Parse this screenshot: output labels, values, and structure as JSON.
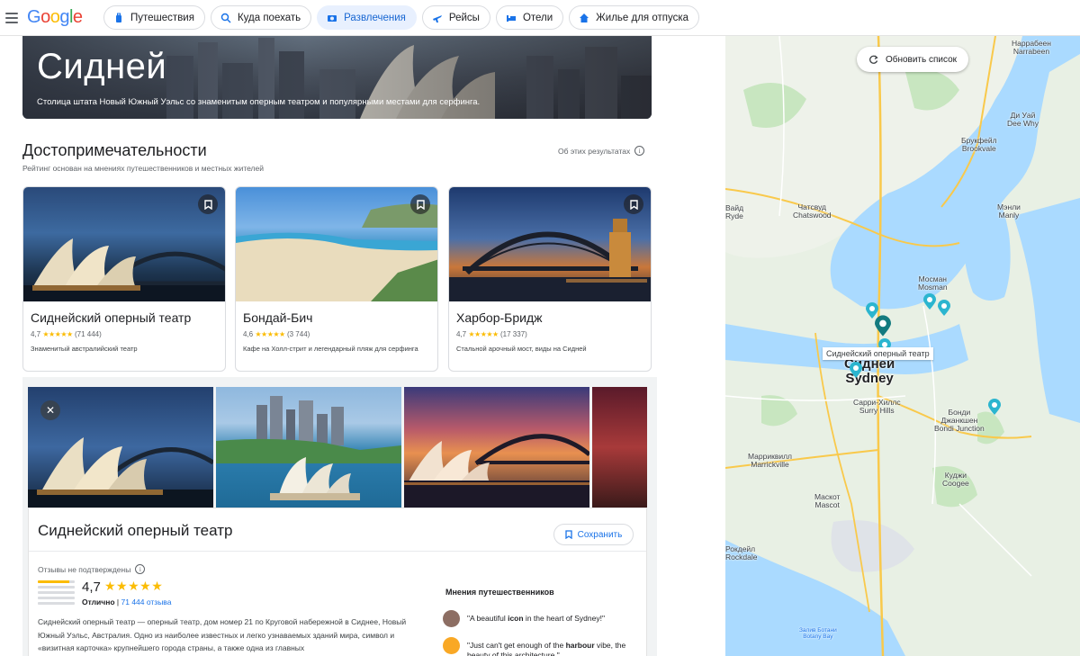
{
  "topbar": {
    "logo": [
      "G",
      "o",
      "o",
      "g",
      "l",
      "e"
    ],
    "chips": [
      {
        "label": "Путешествия",
        "icon": "luggage-icon",
        "active": false
      },
      {
        "label": "Куда поехать",
        "icon": "explore-icon",
        "active": false
      },
      {
        "label": "Развлечения",
        "icon": "camera-icon",
        "active": true
      },
      {
        "label": "Рейсы",
        "icon": "flight-icon",
        "active": false
      },
      {
        "label": "Отели",
        "icon": "hotel-icon",
        "active": false
      },
      {
        "label": "Жилье для отпуска",
        "icon": "house-icon",
        "active": false
      }
    ]
  },
  "hero": {
    "title": "Сидней",
    "subtitle": "Столица штата Новый Южный Уэльс со знаменитым оперным театром и популярными местами для серфинга."
  },
  "section": {
    "title": "Достопримечательности",
    "subtitle": "Рейтинг основан на мнениях путешественников и местных жителей",
    "about": "Об этих результатах"
  },
  "cards": [
    {
      "name": "Сиднейский оперный театр",
      "rating": "4,7",
      "stars": "★★★★★",
      "count": "(71 444)",
      "desc": "Знаменитый австралийский театр"
    },
    {
      "name": "Бондай-Бич",
      "rating": "4,6",
      "stars": "★★★★★",
      "count": "(3 744)",
      "desc": "Кафе на Холл-стрит и легендарный пляж для серфинга"
    },
    {
      "name": "Харбор-Бридж",
      "rating": "4,7",
      "stars": "★★★★★",
      "count": "(17 337)",
      "desc": "Стальной арочный мост, виды на Сидней"
    }
  ],
  "detail": {
    "title": "Сиднейский оперный театр",
    "save": "Сохранить",
    "unverified": "Отзывы не подтверждены",
    "rating": "4,7",
    "stars": "★★★★★",
    "excellent": "Отлично",
    "sep": " | ",
    "reviews": "71 444 отзыва",
    "description": "Сиднейский оперный театр — оперный театр, дом номер 21 по Круговой набережной в Сиднее, Новый Южный Уэльс, Австралия. Одно из наиболее известных и легко узнаваемых зданий мира, символ и «визитная карточка» крупнейшего города страны, а также одна из главных",
    "opinions_title": "Мнения путешественников",
    "opinions": [
      {
        "pre": "\"A beautiful ",
        "bold": "icon",
        "post": " in the heart of Sydney!\"",
        "avatar_color": "#8d6e63"
      },
      {
        "pre": "\"Just can't get enough of the ",
        "bold": "harbour",
        "post": " vibe, the beauty of this architecture.\"",
        "avatar_color": "#f9a825"
      }
    ]
  },
  "map": {
    "refresh": "Обновить список",
    "labels": [
      {
        "text": "Наррабеен",
        "text2": "Narrabeen"
      },
      {
        "text": "Ди Уай",
        "text2": "Dee Why"
      },
      {
        "text": "Брукфейл",
        "text2": "Brookvale"
      },
      {
        "text": "Чатсвуд",
        "text2": "Chatswood"
      },
      {
        "text": "Мэнли",
        "text2": "Manly"
      },
      {
        "text": "Мосман",
        "text2": "Mosman"
      },
      {
        "text": "Сидней",
        "text2": "Sydney"
      },
      {
        "text": "Сарри-Хиллс",
        "text2": "Surry Hills"
      },
      {
        "text": "Бонди",
        "text2": "Джанкшен"
      },
      {
        "text": "Bondi Junction",
        "text2": ""
      },
      {
        "text": "Марриквилл",
        "text2": "Marrickville"
      },
      {
        "text": "Куджи",
        "text2": "Coogee"
      },
      {
        "text": "Маскот",
        "text2": "Mascot"
      },
      {
        "text": "Рокдейл",
        "text2": "Rockdale"
      },
      {
        "text": "Залив Ботани",
        "text2": "Botany Bay"
      },
      {
        "text": "Вайд",
        "text2": "Ryde"
      }
    ],
    "tooltip": "Сиднейский оперный театр"
  }
}
